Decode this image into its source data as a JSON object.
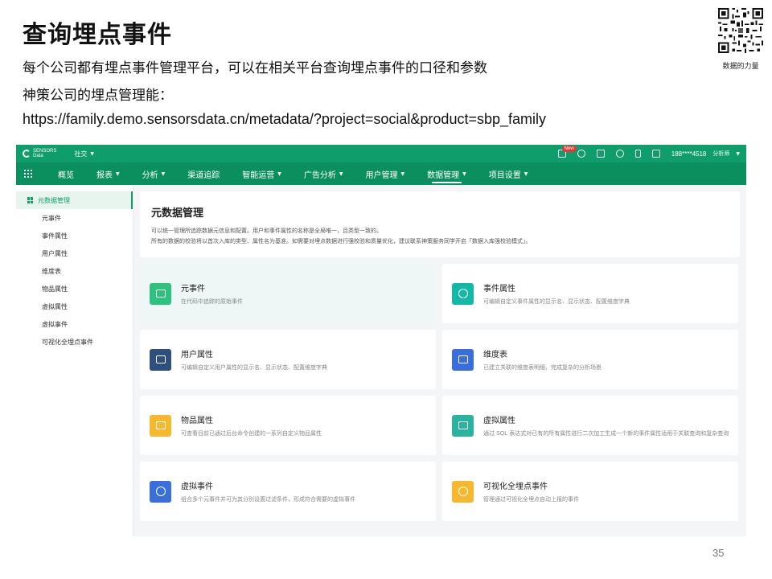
{
  "slide": {
    "title": "查询埋点事件",
    "line1": "每个公司都有埋点事件管理平台，可以在相关平台查询埋点事件的口径和参数",
    "line2": "神策公司的埋点管理能：",
    "line3": "https://family.demo.sensorsdata.cn/metadata/?project=social&product=sbp_family",
    "qr_caption": "数据的力量",
    "page_number": "35"
  },
  "app": {
    "topbar": {
      "logo_line1": "SENSORS",
      "logo_line2": "Data",
      "project": "社交",
      "new_badge": "New",
      "user": "188****4518",
      "role": "分析师"
    },
    "nav": [
      "概览",
      "报表",
      "分析",
      "渠道追踪",
      "智能运营",
      "广告分析",
      "用户管理",
      "数据管理",
      "项目设置"
    ],
    "sidebar": {
      "head": "元数据管理",
      "items": [
        "元事件",
        "事件属性",
        "用户属性",
        "维度表",
        "物品属性",
        "虚拟属性",
        "虚拟事件",
        "可视化全埋点事件"
      ]
    },
    "intro": {
      "title": "元数据管理",
      "desc1": "可以统一管理所追踪数据元信息和配置。用户和事件属性的名称是全局唯一，且类型一致的。",
      "desc2": "所有的数据的校验将以首次入库的类型、属性名为基准。如需要对埋点数据进行强校验和质量优化，建议联系神策服务同学开启「数据入库强校验模式」。"
    },
    "cards": [
      {
        "title": "元事件",
        "desc": "在代码中追踪的原始事件",
        "color": "#2ec27e"
      },
      {
        "title": "事件属性",
        "desc": "可编辑自定义事件属性的显示名、显示状态、配置维度字典",
        "color": "#14b8a6"
      },
      {
        "title": "用户属性",
        "desc": "可编辑自定义用户属性的显示名、显示状态、配置维度字典",
        "color": "#2f4f7f"
      },
      {
        "title": "维度表",
        "desc": "已建立关联的维度表明细，完成复杂的分析场景",
        "color": "#3b6fd8"
      },
      {
        "title": "物品属性",
        "desc": "可查看目前已通过后台命令创建的一系列自定义物品属性",
        "color": "#f5b82e"
      },
      {
        "title": "虚拟属性",
        "desc": "通过 SQL 表达式对已有的所有属性进行二次加工生成一个新的事件属性适用于关联查询和复杂查询",
        "color": "#2bb3a0"
      },
      {
        "title": "虚拟事件",
        "desc": "组合多个元事件并可为其分别设置过滤条件，形成符合需要的虚拟事件",
        "color": "#3b6fd8"
      },
      {
        "title": "可视化全埋点事件",
        "desc": "管理通过可视化全埋点自动上报的事件",
        "color": "#f5b82e"
      }
    ]
  }
}
